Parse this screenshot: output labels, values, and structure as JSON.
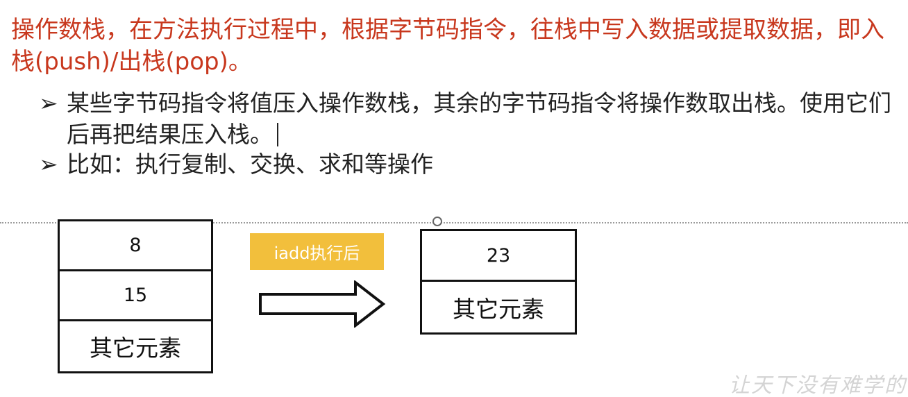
{
  "heading": "操作数栈，在方法执行过程中，根据字节码指令，往栈中写入数据或提取数据，即入栈(push)/出栈(pop)。",
  "bullets": [
    {
      "marker": "➢",
      "text": "某些字节码指令将值压入操作数栈，其余的字节码指令将操作数取出栈。使用它们后再把结果压入栈。"
    },
    {
      "marker": "➢",
      "text": "比如：执行复制、交换、求和等操作"
    }
  ],
  "diagram": {
    "before_stack": [
      "8",
      "15",
      "其它元素"
    ],
    "operation_label": "iadd执行后",
    "after_stack": [
      "23",
      "其它元素"
    ]
  },
  "watermark": "让天下没有难学的",
  "colors": {
    "heading": "#c8381e",
    "badge": "#f2bf3c"
  }
}
